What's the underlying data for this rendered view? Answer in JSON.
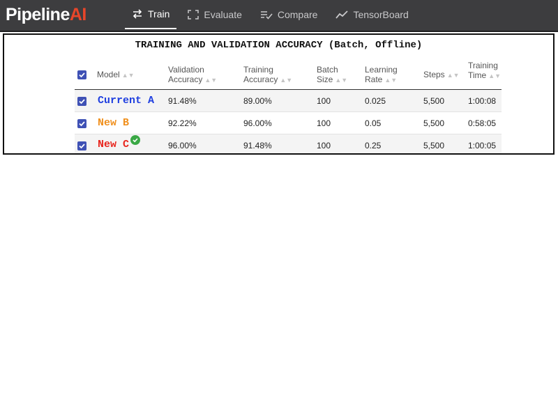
{
  "app": {
    "logo_main": "Pipeline",
    "logo_accent": "AI"
  },
  "nav": {
    "tabs": [
      {
        "label": "Train",
        "icon": "swap-arrows-icon",
        "active": true
      },
      {
        "label": "Evaluate",
        "icon": "fullscreen-brackets-icon",
        "active": false
      },
      {
        "label": "Compare",
        "icon": "list-check-icon",
        "active": false
      },
      {
        "label": "TensorBoard",
        "icon": "line-chart-icon",
        "active": false
      }
    ]
  },
  "panel": {
    "title": "TRAINING AND VALIDATION ACCURACY (Batch, Offline)"
  },
  "table": {
    "headers": {
      "model": "Model",
      "validation_1": "Validation",
      "validation_2": "Accuracy",
      "training_acc_1": "Training",
      "training_acc_2": "Accuracy",
      "batch_1": "Batch",
      "batch_2": "Size",
      "lr_1": "Learning",
      "lr_2": "Rate",
      "steps": "Steps",
      "time_1": "Training",
      "time_2": "Time"
    },
    "rows": [
      {
        "model": "Current A",
        "color": "#1f3fe0",
        "validation_accuracy": "91.48%",
        "training_accuracy": "89.00%",
        "batch_size": "100",
        "learning_rate": "0.025",
        "steps": "5,500",
        "training_time": "1:00:08",
        "checked": true,
        "winner": false
      },
      {
        "model": "New B",
        "color": "#f0901e",
        "validation_accuracy": "92.22%",
        "training_accuracy": "96.00%",
        "batch_size": "100",
        "learning_rate": "0.05",
        "steps": "5,500",
        "training_time": "0:58:05",
        "checked": true,
        "winner": false
      },
      {
        "model": "New C",
        "color": "#e8261e",
        "validation_accuracy": "96.00%",
        "training_accuracy": "91.48%",
        "batch_size": "100",
        "learning_rate": "0.25",
        "steps": "5,500",
        "training_time": "1:00:05",
        "checked": true,
        "winner": true
      }
    ]
  },
  "colors": {
    "topbar": "#3d3d3f",
    "checkbox": "#3f51b5",
    "winner_badge": "#3aa845",
    "logo_accent": "#e8462a"
  }
}
